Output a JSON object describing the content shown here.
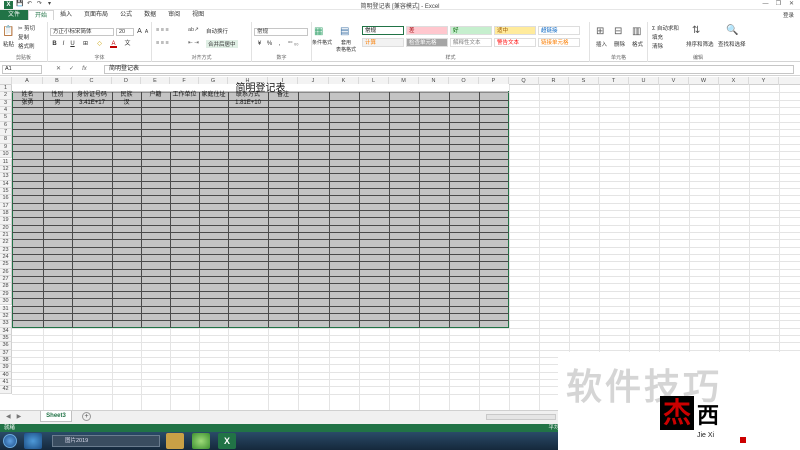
{
  "window": {
    "title": "简明登记表 [兼容模式] - Excel",
    "minimize": "—",
    "restore": "❐",
    "close": "✕"
  },
  "quick_access": {
    "logo": "X",
    "save": "💾",
    "undo": "↶",
    "redo": "↷",
    "more": "▾"
  },
  "tabs": [
    {
      "label": "文件",
      "kind": "file"
    },
    {
      "label": "开始",
      "kind": "active"
    },
    {
      "label": "插入"
    },
    {
      "label": "页面布局"
    },
    {
      "label": "公式"
    },
    {
      "label": "数据"
    },
    {
      "label": "审阅"
    },
    {
      "label": "视图"
    }
  ],
  "login": "登录",
  "ribbon": {
    "clipboard": {
      "cut": "✂ 剪切",
      "copy": "复制",
      "painter": "格式刷",
      "paste": "粘贴",
      "label": "剪贴板"
    },
    "font": {
      "name": "方正小标宋简体",
      "size": "20",
      "grow": "A",
      "shrink": "A",
      "bold": "B",
      "italic": "I",
      "underline": "U",
      "border": "⊞",
      "fill": "◇",
      "color": "A",
      "wen": "文",
      "label": "字体"
    },
    "alignment": {
      "wrap": "自动换行",
      "merge": "合并后居中",
      "label": "对齐方式"
    },
    "number": {
      "format": "常规",
      "percent": "%",
      "comma": ",",
      "currency": "¥",
      "label": "数字"
    },
    "styles": {
      "conditional": "条件格式",
      "table": "套用\n表格格式",
      "cells": [
        {
          "label": "常规",
          "bg": "#ffffff",
          "fg": "#000000"
        },
        {
          "label": "差",
          "bg": "#ffc7ce",
          "fg": "#9c0006"
        },
        {
          "label": "好",
          "bg": "#c6efce",
          "fg": "#006100"
        },
        {
          "label": "适中",
          "bg": "#ffeb9c",
          "fg": "#9c5700"
        },
        {
          "label": "超链接",
          "bg": "#ffffff",
          "fg": "#0563c1"
        },
        {
          "label": "计算",
          "bg": "#f2f2f2",
          "fg": "#fa7d00"
        },
        {
          "label": "检查单元格",
          "bg": "#a5a5a5",
          "fg": "#ffffff"
        },
        {
          "label": "解释性文本",
          "bg": "#ffffff",
          "fg": "#7f7f7f"
        },
        {
          "label": "警告文本",
          "bg": "#ffffff",
          "fg": "#ff0000"
        },
        {
          "label": "链接单元格",
          "bg": "#ffffff",
          "fg": "#fa7d00"
        }
      ],
      "label": "样式"
    },
    "cells": {
      "insert": "插入",
      "delete": "删除",
      "format": "格式",
      "label": "单元格"
    },
    "editing": {
      "autosum": "Σ 自动求和",
      "fill": "填充",
      "clear": "清除",
      "sort": "排序和筛选",
      "find": "查找和选择",
      "label": "编辑"
    }
  },
  "formula_bar": {
    "name_box": "A1",
    "cancel": "✕",
    "enter": "✓",
    "fx": "fx",
    "content": "简明登记表"
  },
  "columns": [
    "A",
    "B",
    "C",
    "D",
    "E",
    "F",
    "G",
    "H",
    "I",
    "J",
    "K",
    "L",
    "M",
    "N",
    "O",
    "P",
    "Q",
    "R",
    "S",
    "T",
    "U",
    "V",
    "W",
    "X",
    "Y"
  ],
  "rows": [
    "1",
    "2",
    "3",
    "4",
    "5",
    "6",
    "7",
    "8",
    "9",
    "10",
    "11",
    "12",
    "13",
    "14",
    "15",
    "16",
    "17",
    "18",
    "19",
    "20",
    "21",
    "22",
    "23",
    "24",
    "25",
    "26",
    "27",
    "28",
    "29",
    "30",
    "31",
    "32",
    "33",
    "34",
    "35",
    "36",
    "37",
    "38",
    "39",
    "40",
    "41",
    "42"
  ],
  "sheet": {
    "title": "简明登记表",
    "headers": [
      "姓名",
      "性别",
      "身份证号码",
      "民族",
      "户籍",
      "工作单位",
      "家庭住址",
      "联系方式",
      "备注"
    ],
    "row3": [
      "张勇",
      "男",
      "3.41E+17",
      "汉",
      "",
      "",
      "",
      "1.81E+10",
      ""
    ]
  },
  "sheet_tabs": {
    "active": "Sheet3",
    "add": "+",
    "nav_prev": "◀",
    "nav_next": "▶"
  },
  "status": {
    "ready": "就绪",
    "average": "平均值"
  },
  "taskbar": {
    "search": "图片2019"
  },
  "watermark": {
    "text": "软件技巧",
    "logo_char": "杰",
    "logo_xi": "西",
    "logo_sub": "Jie Xi"
  }
}
